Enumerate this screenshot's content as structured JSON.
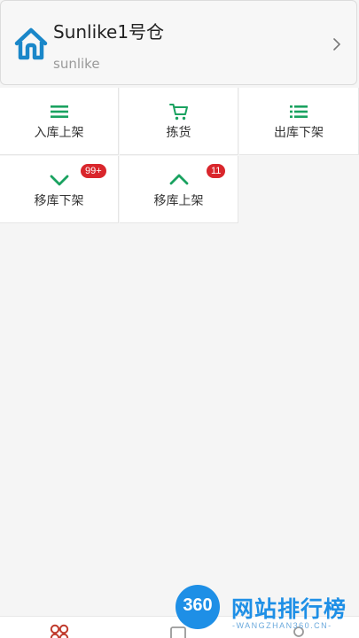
{
  "warehouse": {
    "title": "Sunlike1号仓",
    "subtitle": "sunlike",
    "icon": "home-icon",
    "accent_color": "#1a87c9"
  },
  "functions": [
    {
      "label": "入库上架",
      "icon": "list-icon",
      "badge": ""
    },
    {
      "label": "拣货",
      "icon": "cart-icon",
      "badge": ""
    },
    {
      "label": "出库下架",
      "icon": "bullet-list-icon",
      "badge": ""
    },
    {
      "label": "移库下架",
      "icon": "chevron-down-icon",
      "badge": "99+"
    },
    {
      "label": "移库上架",
      "icon": "chevron-up-icon",
      "badge": "11"
    }
  ],
  "theme": {
    "icon_color": "#1aa260",
    "badge_color": "#d9262c"
  },
  "watermark": {
    "logo_text": "360",
    "title": "网站排行榜",
    "subtitle": "-WANGZHAN360.CN-"
  }
}
